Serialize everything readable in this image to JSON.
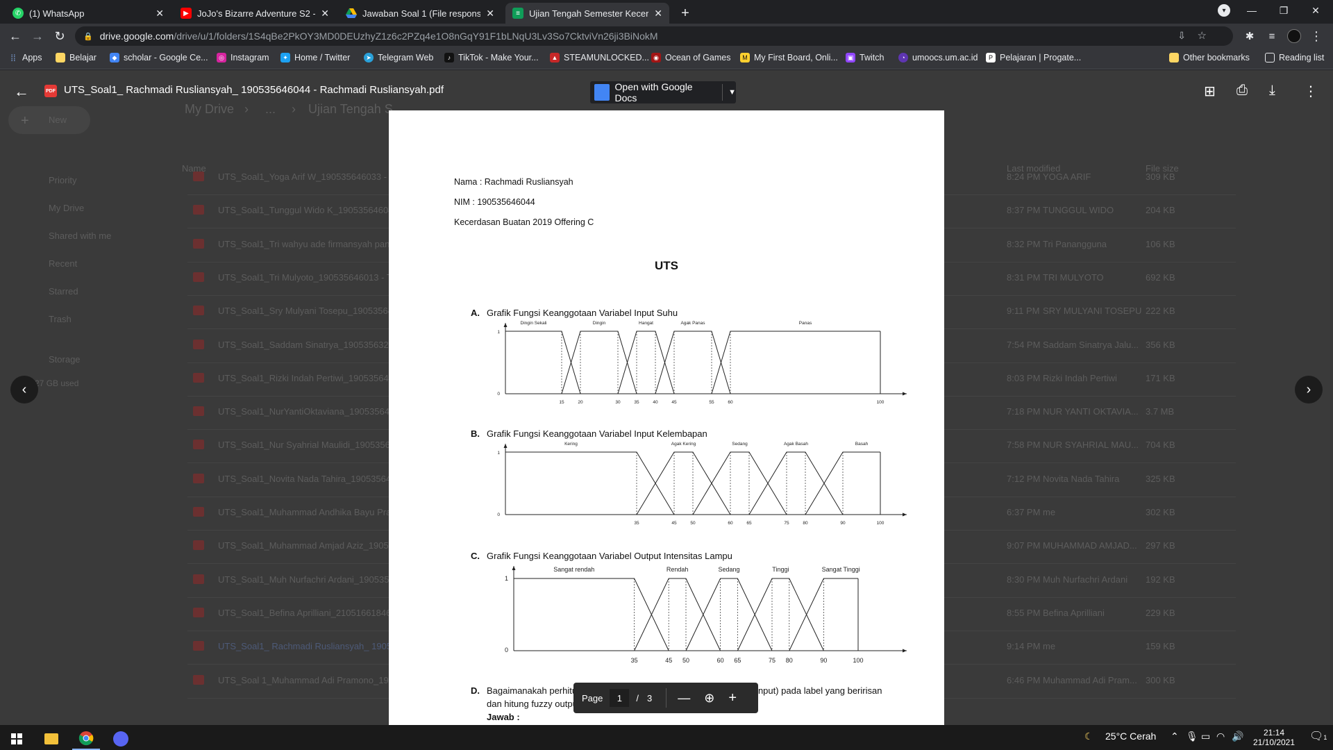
{
  "tabs": [
    {
      "title": "(1) WhatsApp",
      "icon": "whatsapp-icon",
      "color": "#25d366"
    },
    {
      "title": "JoJo's Bizarre Adventure S2 - Epi",
      "icon": "youtube-icon",
      "color": "#ff0000"
    },
    {
      "title": "Jawaban Soal 1 (File responses) -",
      "icon": "google-drive-icon",
      "color": "#fbbc04"
    },
    {
      "title": "Ujian Tengah Semester Kecerdas",
      "icon": "google-forms-icon",
      "color": "#0f9d58"
    }
  ],
  "address_bar": {
    "host": "drive.google.com",
    "path": "/drive/u/1/folders/1S4qBe2PkOY3MD0DEUzhyZ1z6c2PZq4e1O8nGqY91F1bLNqU3Lv3So7CktviVn26ji3BiNokM"
  },
  "bookmarks": [
    {
      "label": "Apps",
      "icon": "apps-grid-icon"
    },
    {
      "label": "Belajar",
      "icon": "folder-icon"
    },
    {
      "label": "scholar - Google Ce...",
      "icon": "scholar-icon"
    },
    {
      "label": "Instagram",
      "icon": "instagram-icon"
    },
    {
      "label": "Home / Twitter",
      "icon": "twitter-icon"
    },
    {
      "label": "Telegram Web",
      "icon": "telegram-icon"
    },
    {
      "label": "TikTok - Make Your...",
      "icon": "tiktok-icon"
    },
    {
      "label": "STEAMUNLOCKED...",
      "icon": "steamunlocked-icon"
    },
    {
      "label": "Ocean of Games",
      "icon": "ocean-of-games-icon"
    },
    {
      "label": "My First Board, Onli...",
      "icon": "miro-icon"
    },
    {
      "label": "Twitch",
      "icon": "twitch-icon"
    },
    {
      "label": "umoocs.um.ac.id",
      "icon": "umoocs-icon"
    },
    {
      "label": "Pelajaran | Progate...",
      "icon": "progate-icon"
    },
    {
      "label": "Other bookmarks",
      "icon": "folder-icon"
    },
    {
      "label": "Reading list",
      "icon": "reading-list-icon"
    }
  ],
  "viewer": {
    "file_title": "UTS_Soal1_ Rachmadi Rusliansyah_ 190535646044 - Rachmadi Rusliansyah.pdf",
    "open_with": "Open with Google Docs",
    "pager": {
      "label": "Page",
      "current": "1",
      "separator": "/",
      "total": "3"
    }
  },
  "drive_background": {
    "breadcrumb": [
      "My Drive",
      "...",
      "Ujian Tengah S"
    ],
    "new_label": "New",
    "nav": [
      "Priority",
      "My Drive",
      "Shared with me",
      "Recent",
      "Starred",
      "Trash",
      "Storage",
      "3.27 GB used"
    ],
    "columns": {
      "name": "Name",
      "modified": "Last modified",
      "size": "File size"
    },
    "rows": [
      {
        "name": "UTS_Soal1_Yoga Arif W_190535646033 -",
        "time": "8:24 PM",
        "owner": "YOGA ARIF",
        "size": "309 KB"
      },
      {
        "name": "UTS_Soal1_Tunggul Wido K_19053564604",
        "time": "8:37 PM",
        "owner": "TUNGGUL WIDO",
        "size": "204 KB"
      },
      {
        "name": "UTS_Soal1_Tri wahyu ade firmansyah pan",
        "time": "8:32 PM",
        "owner": "Tri Panangguna",
        "size": "106 KB"
      },
      {
        "name": "UTS_Soal1_Tri Mulyoto_190535646013 - T",
        "time": "8:31 PM",
        "owner": "TRI MULYOTO",
        "size": "692 KB"
      },
      {
        "name": "UTS_Soal1_Sry Mulyani Tosepu_19053564",
        "time": "9:11 PM",
        "owner": "SRY MULYANI TOSEPU",
        "size": "222 KB"
      },
      {
        "name": "UTS_Soal1_Saddam Sinatrya_1905356325",
        "time": "7:54 PM",
        "owner": "Saddam Sinatrya Jalu...",
        "size": "356 KB"
      },
      {
        "name": "UTS_Soal1_Rizki Indah Pertiwi_19053564",
        "time": "8:03 PM",
        "owner": "Rizki Indah Pertiwi",
        "size": "171 KB"
      },
      {
        "name": "UTS_Soal1_NurYantiOktaviana_19053564",
        "time": "7:18 PM",
        "owner": "NUR YANTI OKTAVIA...",
        "size": "3.7 MB"
      },
      {
        "name": "UTS_Soal1_Nur Syahrial Maulidi_1905356",
        "time": "7:58 PM",
        "owner": "NUR SYAHRIAL MAU...",
        "size": "704 KB"
      },
      {
        "name": "UTS_Soal1_Novita Nada Tahira_19053564",
        "time": "7:12 PM",
        "owner": "Novita Nada Tahira",
        "size": "325 KB"
      },
      {
        "name": "UTS_Soal1_Muhammad Andhika Bayu Pra",
        "time": "6:37 PM",
        "owner": "me",
        "size": "302 KB"
      },
      {
        "name": "UTS_Soal1_Muhammad Amjad Aziz_1905",
        "time": "9:07 PM",
        "owner": "MUHAMMAD AMJAD...",
        "size": "297 KB"
      },
      {
        "name": "UTS_Soal1_Muh Nurfachri Ardani_190535",
        "time": "8:30 PM",
        "owner": "Muh Nurfachri Ardani",
        "size": "192 KB"
      },
      {
        "name": "UTS_Soal1_Befina Aprilliani_21051661846",
        "time": "8:55 PM",
        "owner": "Befina Aprilliani",
        "size": "229 KB"
      },
      {
        "name": "UTS_Soal1_ Rachmadi Rusliansyah_ 1905",
        "time": "9:14 PM",
        "owner": "me",
        "size": "159 KB"
      },
      {
        "name": "UTS_Soal 1_Muhammad Adi Pramono_19",
        "time": "6:46 PM",
        "owner": "Muhammad Adi Pram...",
        "size": "300 KB"
      }
    ]
  },
  "document": {
    "name_line": "Nama : Rachmadi Rusliansyah",
    "nim_line": "NIM : 190535646044",
    "course_line": "Kecerdasan Buatan 2019 Offering C",
    "heading": "UTS",
    "sections": [
      {
        "letter": "A.",
        "title": "Grafik Fungsi Keanggotaan Variabel Input Suhu"
      },
      {
        "letter": "B.",
        "title": "Grafik Fungsi Keanggotaan Variabel Input Kelembapan"
      },
      {
        "letter": "C.",
        "title": "Grafik Fungsi Keanggotaan Variabel Output Intensitas Lampu"
      },
      {
        "letter": "D.",
        "title": "Bagaimanakah perhitungan fuzzifikasi pada (ambil salah satu crisp input) pada label yang beririsan",
        "title2": "dan hitung fuzzy output dengan metode Mamdani",
        "answer": "Jawab :"
      }
    ]
  },
  "chart_data": [
    {
      "type": "line",
      "y_ticks": [
        "1",
        "0"
      ],
      "x_ticks": [
        "15",
        "20",
        "30",
        "35",
        "40",
        "45",
        "55",
        "60",
        "100"
      ],
      "series": [
        {
          "name": "Dingin Sekali",
          "points": [
            [
              0,
              1
            ],
            [
              15,
              1
            ],
            [
              20,
              0
            ]
          ]
        },
        {
          "name": "Dingin",
          "points": [
            [
              15,
              0
            ],
            [
              20,
              1
            ],
            [
              30,
              1
            ],
            [
              35,
              0
            ]
          ]
        },
        {
          "name": "Hangat",
          "points": [
            [
              30,
              0
            ],
            [
              35,
              1
            ],
            [
              40,
              1
            ],
            [
              45,
              0
            ]
          ]
        },
        {
          "name": "Agak Panas",
          "points": [
            [
              40,
              0
            ],
            [
              45,
              1
            ],
            [
              55,
              1
            ],
            [
              60,
              0
            ]
          ]
        },
        {
          "name": "Panas",
          "points": [
            [
              55,
              0
            ],
            [
              60,
              1
            ],
            [
              100,
              1
            ]
          ]
        }
      ]
    },
    {
      "type": "line",
      "y_ticks": [
        "1",
        "0"
      ],
      "x_ticks": [
        "35",
        "45",
        "50",
        "60",
        "65",
        "75",
        "80",
        "90",
        "100"
      ],
      "series": [
        {
          "name": "Kering",
          "points": [
            [
              0,
              1
            ],
            [
              35,
              1
            ],
            [
              45,
              0
            ]
          ]
        },
        {
          "name": "Agak Kering",
          "points": [
            [
              35,
              0
            ],
            [
              45,
              1
            ],
            [
              50,
              1
            ],
            [
              60,
              0
            ]
          ]
        },
        {
          "name": "Sedang",
          "points": [
            [
              50,
              0
            ],
            [
              60,
              1
            ],
            [
              65,
              1
            ],
            [
              75,
              0
            ]
          ]
        },
        {
          "name": "Agak Basah",
          "points": [
            [
              65,
              0
            ],
            [
              75,
              1
            ],
            [
              80,
              1
            ],
            [
              90,
              0
            ]
          ]
        },
        {
          "name": "Basah",
          "points": [
            [
              80,
              0
            ],
            [
              90,
              1
            ],
            [
              100,
              1
            ]
          ]
        }
      ]
    },
    {
      "type": "line",
      "y_ticks": [
        "1",
        "0"
      ],
      "x_ticks": [
        "35",
        "45",
        "50",
        "60",
        "65",
        "75",
        "80",
        "90",
        "100"
      ],
      "series": [
        {
          "name": "Sangat rendah",
          "points": [
            [
              0,
              1
            ],
            [
              35,
              1
            ],
            [
              45,
              0
            ]
          ]
        },
        {
          "name": "Rendah",
          "points": [
            [
              35,
              0
            ],
            [
              45,
              1
            ],
            [
              50,
              1
            ],
            [
              60,
              0
            ]
          ]
        },
        {
          "name": "Sedang",
          "points": [
            [
              50,
              0
            ],
            [
              60,
              1
            ],
            [
              65,
              1
            ],
            [
              75,
              0
            ]
          ]
        },
        {
          "name": "Tinggi",
          "points": [
            [
              65,
              0
            ],
            [
              75,
              1
            ],
            [
              80,
              1
            ],
            [
              90,
              0
            ]
          ]
        },
        {
          "name": "Sangat Tinggi",
          "points": [
            [
              80,
              0
            ],
            [
              90,
              1
            ],
            [
              100,
              1
            ]
          ]
        }
      ]
    }
  ],
  "taskbar": {
    "weather": "25°C  Cerah",
    "time": "21:14",
    "date": "21/10/2021",
    "notification_count": "1"
  }
}
